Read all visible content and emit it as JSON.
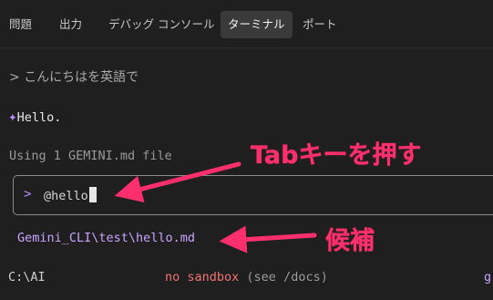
{
  "panel_tabs": [
    {
      "label": "問題",
      "active": false
    },
    {
      "label": "出力",
      "active": false
    },
    {
      "label": "デバッグ コンソール",
      "active": false
    },
    {
      "label": "ターミナル",
      "active": true
    },
    {
      "label": "ポート",
      "active": false
    }
  ],
  "terminal": {
    "user_prompt_marker": ">",
    "user_prompt_text": "こんにちはを英語で",
    "reply_icon": "sparkle-icon",
    "reply_text": "Hello.",
    "context_line": "Using 1 GEMINI.md file",
    "input": {
      "prompt_marker": ">",
      "value": "@hello"
    },
    "suggestion": "Gemini_CLI\\test\\hello.md"
  },
  "status_bar": {
    "cwd": "C:\\AI",
    "sandbox": "no sandbox",
    "sandbox_hint": "(see /docs)",
    "right_clip": "g"
  },
  "annotations": {
    "tab_key_note": "Tabキーを押す",
    "candidate_note": "候補"
  },
  "colors": {
    "background": "#1f1f1f",
    "accent_purple": "#b58cff",
    "annotation_pink": "#ff2f6d",
    "sandbox_red": "#f07373"
  }
}
